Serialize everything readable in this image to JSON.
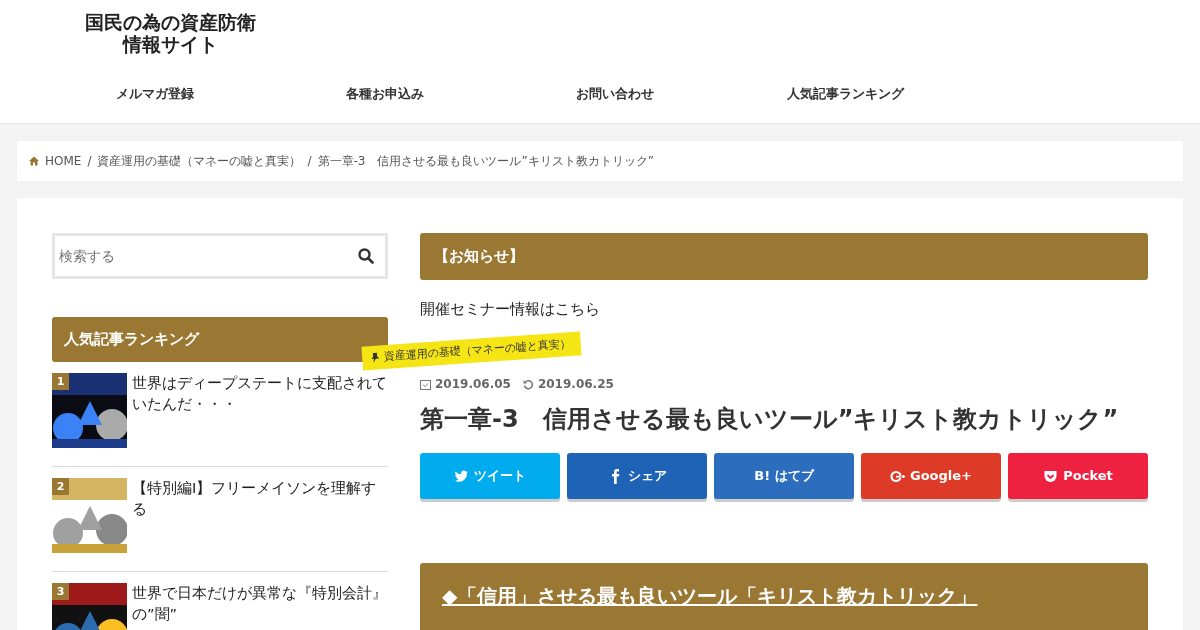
{
  "site": {
    "title_line1": "国民の為の資産防衛",
    "title_line2": "情報サイト"
  },
  "nav": [
    {
      "label": "メルマガ登録"
    },
    {
      "label": "各種お申込み"
    },
    {
      "label": "お問い合わせ"
    },
    {
      "label": "人気記事ランキング"
    }
  ],
  "breadcrumb_separator": "/",
  "breadcrumb": [
    {
      "label": "HOME",
      "kind": "home"
    },
    {
      "label": "資産運用の基礎（マネーの嘘と真実）",
      "kind": "link"
    },
    {
      "label": "第一章-3　信用させる最も良いツール”キリスト教カトリック”",
      "kind": "current"
    }
  ],
  "sidebar": {
    "search": {
      "placeholder": "検索する"
    },
    "ranking_title": "人気記事ランキング",
    "ranking": [
      {
        "rank": "1",
        "title": "世界はディープステートに支配されていたんだ・・・",
        "kind": "picture"
      },
      {
        "rank": "2",
        "title": "【特別編Ⅰ】フリーメイソンを理解する",
        "kind": "picture"
      },
      {
        "rank": "3",
        "title": "世界で日本だけが異常な『特別会計』の”闇”",
        "kind": "picture"
      }
    ]
  },
  "notice": {
    "heading": "【お知らせ】",
    "link": "開催セミナー情報はこちら"
  },
  "article": {
    "category": "資産運用の基礎（マネーの嘘と真実）",
    "published": "2019.06.05",
    "updated": "2019.06.25",
    "title": "第一章-3　信用させる最も良いツール”キリスト教カトリック”",
    "share": [
      {
        "kind": "twitter",
        "label": "ツイート"
      },
      {
        "kind": "facebook",
        "label": "シェア"
      },
      {
        "kind": "hatena",
        "label": "B! はてブ"
      },
      {
        "kind": "google",
        "label": "Google+"
      },
      {
        "kind": "pocket",
        "label": "Pocket"
      }
    ],
    "section_heading": "◆「信用」させる最も良いツール「キリスト教カトリック」"
  }
}
